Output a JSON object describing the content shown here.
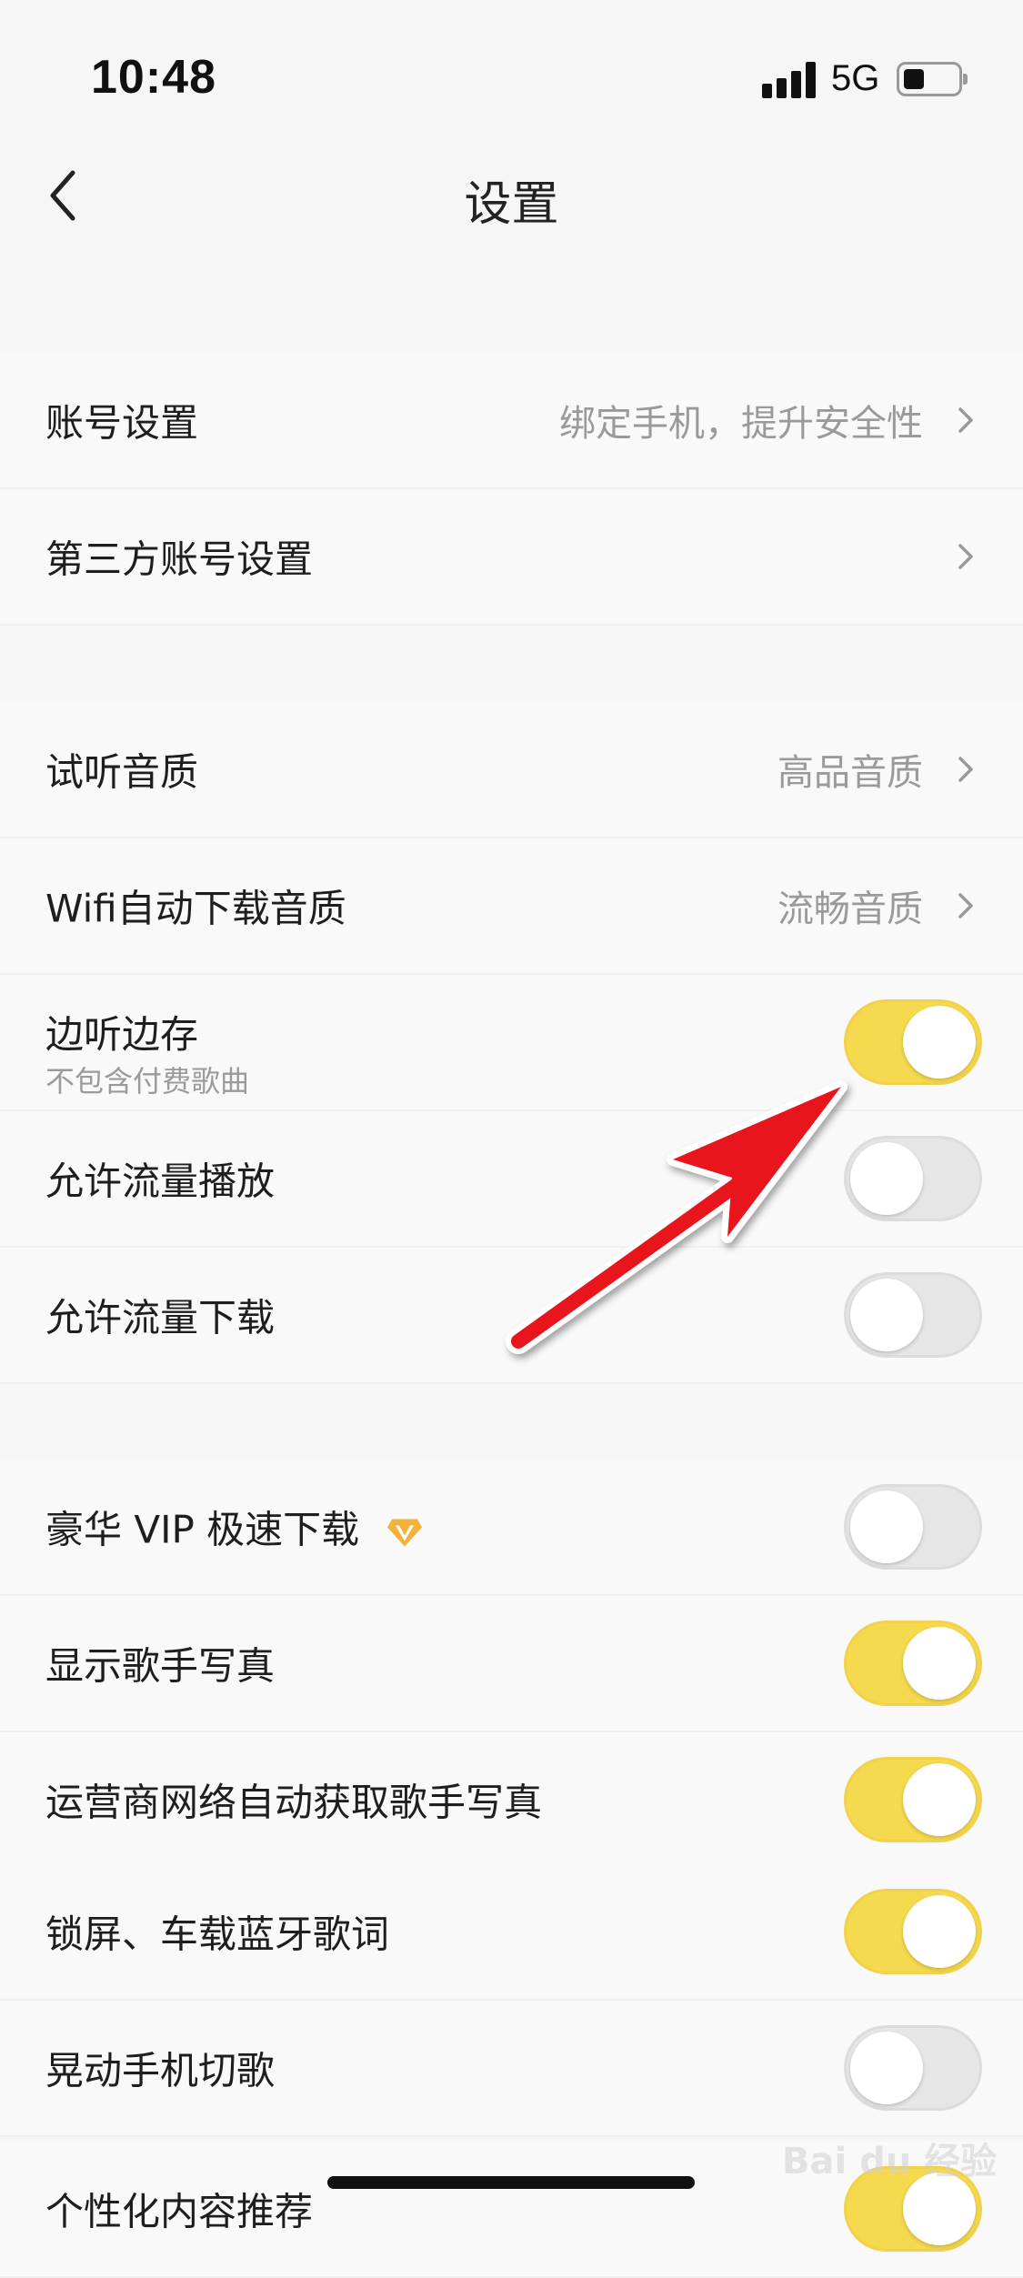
{
  "status_bar": {
    "time": "10:48",
    "network": "5G",
    "battery_level": 0.4
  },
  "nav": {
    "back_icon": "chevron-left-icon",
    "title": "设置"
  },
  "groups": [
    {
      "rows": [
        {
          "id": "account",
          "label": "账号设置",
          "value": "绑定手机，提升安全性",
          "type": "link"
        },
        {
          "id": "third-party",
          "label": "第三方账号设置",
          "value": "",
          "type": "link"
        }
      ]
    },
    {
      "rows": [
        {
          "id": "preview-quality",
          "label": "试听音质",
          "value": "高品音质",
          "type": "link"
        },
        {
          "id": "wifi-download-quality",
          "label": "Wifi自动下载音质",
          "value": "流畅音质",
          "type": "link"
        },
        {
          "id": "cache-while-listening",
          "label": "边听边存",
          "sublabel": "不包含付费歌曲",
          "type": "toggle",
          "on": true
        },
        {
          "id": "allow-data-play",
          "label": "允许流量播放",
          "type": "toggle",
          "on": false
        },
        {
          "id": "allow-data-download",
          "label": "允许流量下载",
          "type": "toggle",
          "on": false
        }
      ]
    },
    {
      "rows": [
        {
          "id": "vip-fast-download",
          "label": "豪华 VIP 极速下载",
          "icon": "vip-diamond-icon",
          "type": "toggle",
          "on": false
        },
        {
          "id": "show-artist-photo",
          "label": "显示歌手写真",
          "type": "toggle",
          "on": true
        },
        {
          "id": "carrier-artist-photo",
          "label": "运营商网络自动获取歌手写真",
          "type": "toggle",
          "on": true
        },
        {
          "id": "lockscreen-lyrics",
          "label": "锁屏、车载蓝牙歌词",
          "type": "toggle",
          "on": true
        },
        {
          "id": "shake-switch",
          "label": "晃动手机切歌",
          "type": "toggle",
          "on": false
        },
        {
          "id": "personalized",
          "label": "个性化内容推荐",
          "type": "toggle",
          "on": true
        }
      ]
    }
  ],
  "colors": {
    "toggle_on": "#f5d94f",
    "toggle_off": "#e6e6e6",
    "arrow": "#e8141c"
  },
  "watermark": {
    "text": "Bai du 经验"
  }
}
